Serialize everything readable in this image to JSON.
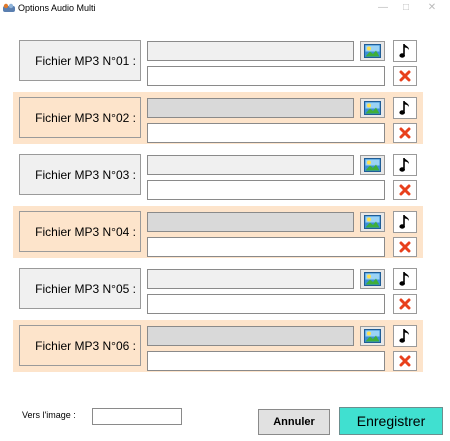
{
  "window": {
    "title": "Options Audio Multi",
    "controls": [
      "minimize-icon",
      "maximize-icon",
      "close-icon"
    ]
  },
  "rows": [
    {
      "label": "Fichier MP3 N°01 :",
      "file_value": "",
      "text_value": "",
      "highlight": false
    },
    {
      "label": "Fichier MP3 N°02 :",
      "file_value": "",
      "text_value": "",
      "highlight": true
    },
    {
      "label": "Fichier MP3 N°03 :",
      "file_value": "",
      "text_value": "",
      "highlight": false
    },
    {
      "label": "Fichier MP3 N°04 :",
      "file_value": "",
      "text_value": "",
      "highlight": true
    },
    {
      "label": "Fichier MP3 N°05 :",
      "file_value": "",
      "text_value": "",
      "highlight": false
    },
    {
      "label": "Fichier MP3 N°06 :",
      "file_value": "",
      "text_value": "",
      "highlight": true
    }
  ],
  "row_buttons": {
    "image_icon": "image-icon",
    "music_icon": "music-note-icon",
    "delete_icon": "delete-x-icon"
  },
  "footer": {
    "image_label": "Vers l'image :",
    "image_value": "",
    "cancel_label": "Annuler",
    "save_label": "Enregistrer"
  },
  "colors": {
    "highlight_row": "#fde4cb",
    "save_button": "#40e0d0",
    "delete_x": "#e8401c"
  }
}
